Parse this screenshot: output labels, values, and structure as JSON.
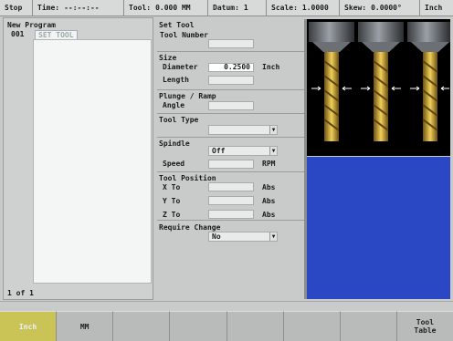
{
  "status_bar": {
    "state": "Stop",
    "time_label": "Time:",
    "time_value": "--:--:--",
    "tool_label": "Tool:",
    "tool_value": "0.000  MM",
    "datum_label": "Datum:",
    "datum_value": "1",
    "scale_label": "Scale:",
    "scale_value": "1.0000",
    "skew_label": "Skew:",
    "skew_value": "0.0000°",
    "units": "Inch"
  },
  "program": {
    "title": "New Program",
    "rows": [
      {
        "num": "001",
        "step": "SET TOOL"
      }
    ],
    "page": "1 of 1"
  },
  "form": {
    "title": "Set Tool",
    "tool_number": {
      "label": "Tool Number",
      "value": ""
    },
    "size": {
      "title": "Size",
      "diameter_label": "Diameter",
      "diameter_value": "0.2500",
      "diameter_unit": "Inch",
      "length_label": "Length",
      "length_value": ""
    },
    "plunge": {
      "title": "Plunge / Ramp",
      "angle_label": "Angle",
      "angle_value": ""
    },
    "tool_type": {
      "label": "Tool Type",
      "value": ""
    },
    "spindle": {
      "title": "Spindle",
      "state": "Off",
      "speed_label": "Speed",
      "speed_value": "",
      "speed_unit": "RPM"
    },
    "tool_position": {
      "title": "Tool Position",
      "x_label": "X To",
      "x_value": "",
      "x_unit": "Abs",
      "y_label": "Y To",
      "y_value": "",
      "y_unit": "Abs",
      "z_label": "Z To",
      "z_value": "",
      "z_unit": "Abs"
    },
    "require_change": {
      "title": "Require Change",
      "value": "No"
    }
  },
  "softkeys": [
    {
      "label": "Inch",
      "active": true
    },
    {
      "label": "MM",
      "active": false
    },
    {
      "label": "",
      "active": false
    },
    {
      "label": "",
      "active": false
    },
    {
      "label": "",
      "active": false
    },
    {
      "label": "",
      "active": false
    },
    {
      "label": "",
      "active": false
    },
    {
      "label": "Tool\nTable",
      "active": false
    }
  ],
  "colors": {
    "graphic_background": "#000000",
    "blue_area": "#2a47c4",
    "bit_gold": "#c9a23a",
    "active_softkey": "#c9c455"
  }
}
